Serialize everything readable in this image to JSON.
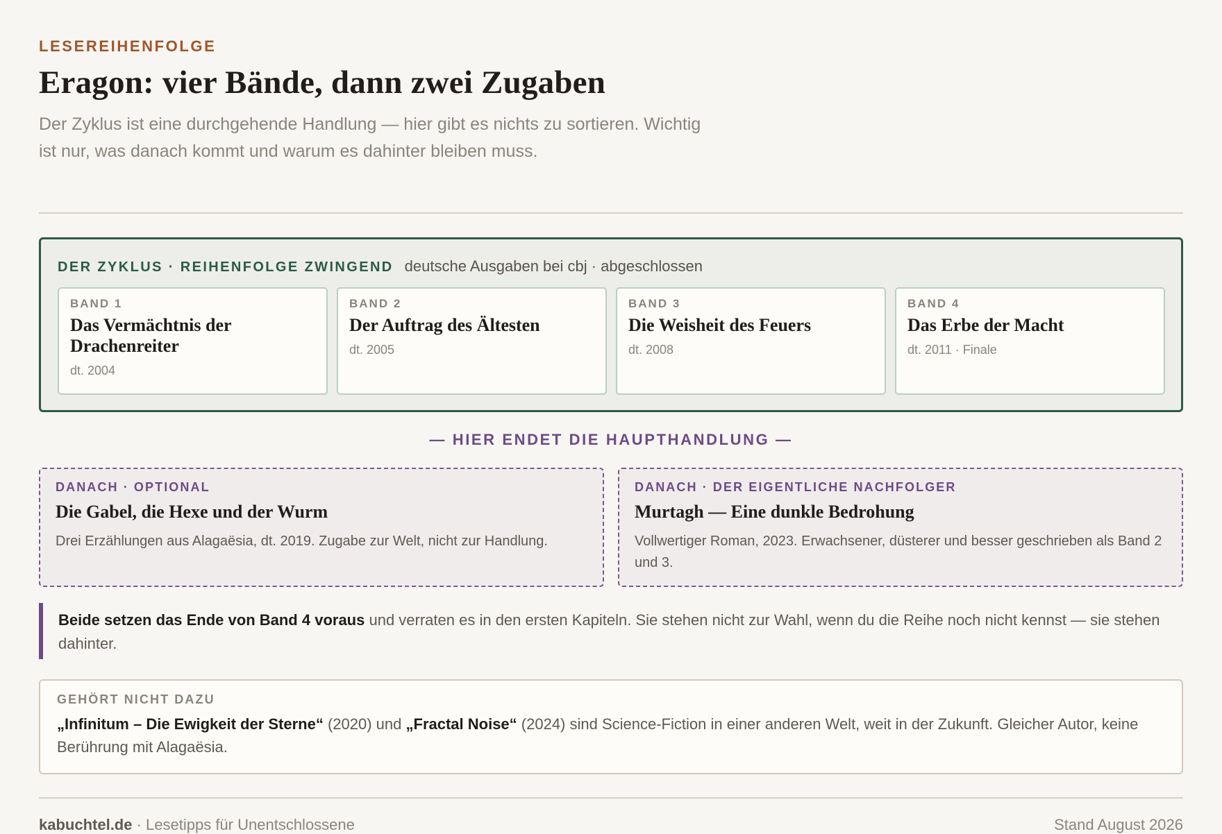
{
  "header": {
    "eyebrow": "LESEREIHENFOLGE",
    "title": "Eragon: vier Bände, dann zwei Zugaben",
    "intro": "Der Zyklus ist eine durchgehende Handlung — hier gibt es nichts zu sortieren. Wichtig ist nur, was danach kommt und warum es dahinter bleiben muss."
  },
  "cycle": {
    "label": "DER ZYKLUS · REIHENFOLGE ZWINGEND",
    "meta": "deutsche Ausgaben bei cbj · abgeschlossen",
    "books": [
      {
        "num": "BAND 1",
        "title": "Das Vermächtnis der Drachenreiter",
        "date": "dt. 2004"
      },
      {
        "num": "BAND 2",
        "title": "Der Auftrag des Ältesten",
        "date": "dt. 2005"
      },
      {
        "num": "BAND 3",
        "title": "Die Weisheit des Feuers",
        "date": "dt. 2008"
      },
      {
        "num": "BAND 4",
        "title": "Das Erbe der Macht",
        "date": "dt. 2011 · Finale"
      }
    ]
  },
  "divider": "— HIER ENDET DIE HAUPTHANDLUNG —",
  "after": [
    {
      "label": "DANACH · OPTIONAL",
      "title": "Die Gabel, die Hexe und der Wurm",
      "text": "Drei Erzählungen aus Alagaësia, dt. 2019. Zugabe zur Welt, nicht zur Handlung."
    },
    {
      "label": "DANACH · DER EIGENTLICHE NACHFOLGER",
      "title": "Murtagh — Eine dunkle Bedrohung",
      "text": "Vollwertiger Roman, 2023. Erwachsener, düsterer und besser geschrieben als Band 2 und 3."
    }
  ],
  "note": {
    "bold": "Beide setzen das Ende von Band 4 voraus",
    "rest": " und verraten es in den ersten Kapiteln. Sie stehen nicht zur Wahl, wenn du die Reihe noch nicht kennst — sie stehen dahinter."
  },
  "aside": {
    "label": "GEHÖRT NICHT DAZU",
    "book1": "„Infinitum – Die Ewigkeit der Sterne“",
    "year1": " (2020) und ",
    "book2": "„Fractal Noise“",
    "rest": " (2024) sind Science-Fiction in einer anderen Welt, weit in der Zukunft. Gleicher Autor, keine Berührung mit Alagaësia."
  },
  "footer": {
    "site": "kabuchtel.de",
    "tagline": " · Lesetipps für Unentschlossene",
    "date": "Stand August 2026"
  },
  "colors": {
    "accent_eyebrow": "#a0552a",
    "cycle_green": "#2b5a49",
    "after_purple": "#6d4b86",
    "background": "#f8f6f2"
  }
}
